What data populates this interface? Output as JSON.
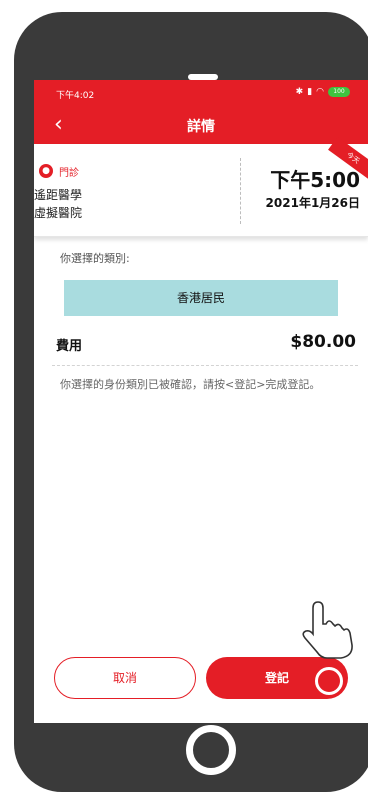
{
  "status": {
    "time": "下午4:02",
    "battery": "100"
  },
  "header": {
    "back": "‹",
    "title": "詳情"
  },
  "card": {
    "clinic_type": "門診",
    "clinic_line1": "遙距醫學",
    "clinic_line2": "虛擬醫院",
    "time": "下午5:00",
    "date": "2021年1月26日",
    "today_badge": "今天"
  },
  "details": {
    "category_label": "你選擇的類別:",
    "category_value": "香港居民",
    "fee_label": "費用",
    "fee_value": "$80.00",
    "message": "你選擇的身份類別已被確認，請按<登記>完成登記。"
  },
  "buttons": {
    "cancel": "取消",
    "register": "登記"
  },
  "colors": {
    "brand_red": "#e41e26",
    "category_bg": "#a9dcdf"
  },
  "icons": [
    "back-icon",
    "clinic-icon",
    "battery-icon",
    "hand-cursor-icon"
  ]
}
